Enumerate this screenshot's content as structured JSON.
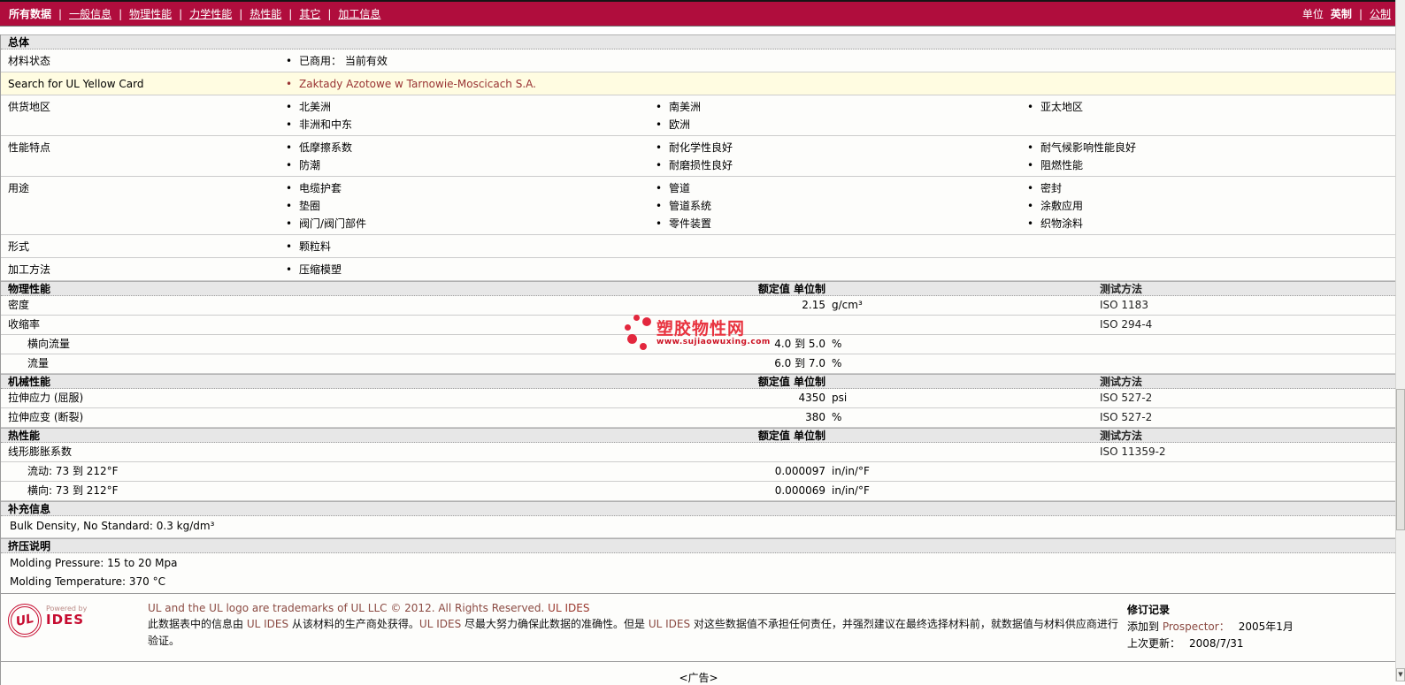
{
  "nav": {
    "tabs": [
      {
        "label": "所有数据",
        "active": true
      },
      {
        "label": "一般信息",
        "active": false
      },
      {
        "label": "物理性能",
        "active": false
      },
      {
        "label": "力学性能",
        "active": false
      },
      {
        "label": "热性能",
        "active": false
      },
      {
        "label": "其它",
        "active": false
      },
      {
        "label": "加工信息",
        "active": false
      }
    ],
    "units_label": "单位",
    "unit_imperial": "英制",
    "unit_metric": "公制",
    "nav_color": "#b00d3d"
  },
  "general": {
    "title": "总体",
    "rows": [
      {
        "type": "bullets",
        "name": "材料状态",
        "cols": [
          [
            "已商用： 当前有效"
          ],
          [],
          []
        ]
      },
      {
        "type": "link",
        "name": "Search for UL Yellow Card",
        "cols": [
          [
            "Zaktady Azotowe w Tarnowie-Moscicach S.A."
          ],
          [],
          []
        ]
      },
      {
        "type": "bullets",
        "name": "供货地区",
        "cols": [
          [
            "北美洲",
            "非洲和中东"
          ],
          [
            "南美洲",
            "欧洲"
          ],
          [
            "亚太地区"
          ]
        ]
      },
      {
        "type": "bullets",
        "name": "性能特点",
        "cols": [
          [
            "低摩擦系数",
            "防潮"
          ],
          [
            "耐化学性良好",
            "耐磨损性良好"
          ],
          [
            "耐气候影响性能良好",
            "阻燃性能"
          ]
        ]
      },
      {
        "type": "bullets",
        "name": "用途",
        "cols": [
          [
            "电缆护套",
            "垫圈",
            "阀门/阀门部件"
          ],
          [
            "管道",
            "管道系统",
            "零件装置"
          ],
          [
            "密封",
            "涂敷应用",
            "织物涂料"
          ]
        ]
      },
      {
        "type": "bullets",
        "name": "形式",
        "cols": [
          [
            "颗粒料"
          ],
          [],
          []
        ]
      },
      {
        "type": "bullets",
        "name": "加工方法",
        "cols": [
          [
            "压缩模塑"
          ],
          [],
          []
        ]
      }
    ]
  },
  "value_sections": [
    {
      "title": "物理性能",
      "col_value": "额定值 单位制",
      "col_test": "测试方法",
      "rows": [
        {
          "name": "密度",
          "indent": false,
          "value": "2.15",
          "unit": "g/cm³",
          "test": "ISO 1183"
        },
        {
          "name": "收缩率",
          "indent": false,
          "value": "",
          "unit": "",
          "test": "ISO 294-4"
        },
        {
          "name": "横向流量",
          "indent": true,
          "value": "4.0 到 5.0",
          "unit": "%",
          "test": ""
        },
        {
          "name": "流量",
          "indent": true,
          "value": "6.0 到 7.0",
          "unit": "%",
          "test": ""
        }
      ]
    },
    {
      "title": "机械性能",
      "col_value": "额定值 单位制",
      "col_test": "测试方法",
      "rows": [
        {
          "name": "拉伸应力 (屈服)",
          "indent": false,
          "value": "4350",
          "unit": "psi",
          "test": "ISO 527-2"
        },
        {
          "name": "拉伸应变 (断裂)",
          "indent": false,
          "value": "380",
          "unit": "%",
          "test": "ISO 527-2"
        }
      ]
    },
    {
      "title": "热性能",
      "col_value": "额定值 单位制",
      "col_test": "测试方法",
      "rows": [
        {
          "name": "线形膨胀系数",
          "indent": false,
          "value": "",
          "unit": "",
          "test": "ISO 11359-2"
        },
        {
          "name": "流动: 73 到 212°F",
          "indent": true,
          "value": "0.000097",
          "unit": "in/in/°F",
          "test": ""
        },
        {
          "name": "横向: 73 到 212°F",
          "indent": true,
          "value": "0.000069",
          "unit": "in/in/°F",
          "test": ""
        }
      ]
    }
  ],
  "text_sections": [
    {
      "title": "补充信息",
      "lines": [
        "Bulk Density, No Standard: 0.3 kg/dm³"
      ],
      "divider": "light"
    },
    {
      "title": "挤压说明",
      "lines": [
        "Molding Pressure: 15 to 20 Mpa",
        "Molding Temperature: 370 °C"
      ],
      "divider": "dark"
    }
  ],
  "watermark": {
    "title": "塑胶物性网",
    "url": "www.sujiaowuxing.com",
    "color": "#e8333f"
  },
  "footer": {
    "logo_text": "UL",
    "powered_by": "Powered by",
    "brand": "IDES",
    "trademark_line": "UL and the UL logo are trademarks of UL LLC © 2012. All Rights Reserved. ",
    "trademark_link": "UL IDES",
    "disclaimer": [
      {
        "t": "此数据表中的信息由 "
      },
      {
        "t": "UL IDES",
        "red": true
      },
      {
        "t": " 从该材料的生产商处获得。"
      },
      {
        "t": "UL IDES",
        "red": true
      },
      {
        "t": " 尽最大努力确保此数据的准确性。但是 "
      },
      {
        "t": "UL IDES",
        "red": true
      },
      {
        "t": " 对这些数据值不承担任何责任，并强烈建议在最终选择材料前，就数据值与材料供应商进行验证。"
      }
    ],
    "revision": {
      "title": "修订记录",
      "added_label": "添加到 ",
      "added_brand": "Prospector：",
      "added_value": "2005年1月",
      "updated_label": "上次更新：",
      "updated_value": "2008/7/31"
    }
  },
  "ad_label": "<广告>"
}
